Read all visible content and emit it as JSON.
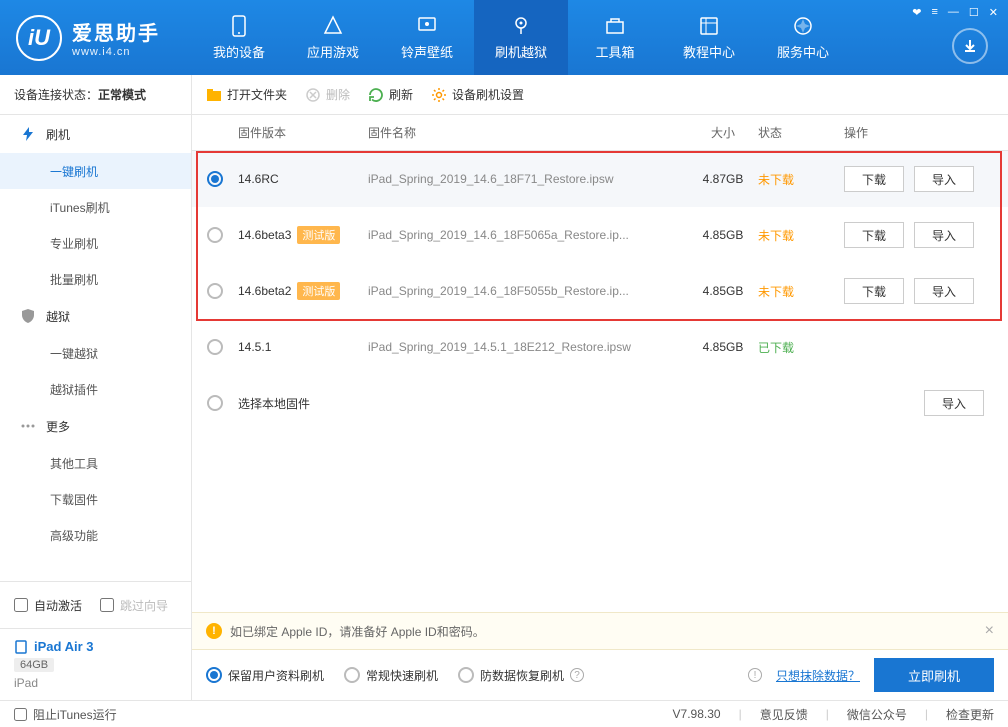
{
  "app": {
    "title": "爱思助手",
    "url": "www.i4.cn"
  },
  "window_icons": [
    "gift",
    "menu",
    "min",
    "max",
    "close"
  ],
  "nav": [
    {
      "label": "我的设备"
    },
    {
      "label": "应用游戏"
    },
    {
      "label": "铃声壁纸"
    },
    {
      "label": "刷机越狱",
      "active": true
    },
    {
      "label": "工具箱"
    },
    {
      "label": "教程中心"
    },
    {
      "label": "服务中心"
    }
  ],
  "status": {
    "label": "设备连接状态：",
    "value": "正常模式"
  },
  "sidebar": {
    "groups": [
      {
        "icon": "flash",
        "label": "刷机",
        "items": [
          {
            "label": "一键刷机",
            "active": true
          },
          {
            "label": "iTunes刷机"
          },
          {
            "label": "专业刷机"
          },
          {
            "label": "批量刷机"
          }
        ]
      },
      {
        "icon": "shield",
        "label": "越狱",
        "items": [
          {
            "label": "一键越狱"
          },
          {
            "label": "越狱插件"
          }
        ]
      },
      {
        "icon": "more",
        "label": "更多",
        "items": [
          {
            "label": "其他工具"
          },
          {
            "label": "下载固件"
          },
          {
            "label": "高级功能"
          }
        ]
      }
    ],
    "auto_activate": "自动激活",
    "skip_guide": "跳过向导"
  },
  "device": {
    "name": "iPad Air 3",
    "storage": "64GB",
    "type": "iPad"
  },
  "toolbar": {
    "open": "打开文件夹",
    "delete": "删除",
    "refresh": "刷新",
    "settings": "设备刷机设置"
  },
  "columns": {
    "version": "固件版本",
    "name": "固件名称",
    "size": "大小",
    "status": "状态",
    "ops": "操作"
  },
  "rows": [
    {
      "selected": true,
      "version": "14.6RC",
      "beta": false,
      "name": "iPad_Spring_2019_14.6_18F71_Restore.ipsw",
      "size": "4.87GB",
      "status": "未下载",
      "status_color": "orange",
      "download": true,
      "import": true
    },
    {
      "version": "14.6beta3",
      "beta": true,
      "name": "iPad_Spring_2019_14.6_18F5065a_Restore.ip...",
      "size": "4.85GB",
      "status": "未下载",
      "status_color": "orange",
      "download": true,
      "import": true
    },
    {
      "version": "14.6beta2",
      "beta": true,
      "name": "iPad_Spring_2019_14.6_18F5055b_Restore.ip...",
      "size": "4.85GB",
      "status": "未下载",
      "status_color": "orange",
      "download": true,
      "import": true
    },
    {
      "version": "14.5.1",
      "beta": false,
      "name": "iPad_Spring_2019_14.5.1_18E212_Restore.ipsw",
      "size": "4.85GB",
      "status": "已下载",
      "status_color": "green",
      "download": false,
      "import": false
    },
    {
      "local": true,
      "version": "选择本地固件",
      "import": true
    }
  ],
  "beta_tag": "测试版",
  "btn": {
    "download": "下载",
    "import": "导入"
  },
  "notice": "如已绑定 Apple ID，请准备好 Apple ID和密码。",
  "flash_modes": [
    {
      "label": "保留用户资料刷机",
      "checked": true
    },
    {
      "label": "常规快速刷机"
    },
    {
      "label": "防数据恢复刷机",
      "help": true
    }
  ],
  "erase_link": "只想抹除数据？",
  "primary": "立即刷机",
  "footer": {
    "block_itunes": "阻止iTunes运行",
    "version": "V7.98.30",
    "feedback": "意见反馈",
    "wechat": "微信公众号",
    "update": "检查更新"
  }
}
